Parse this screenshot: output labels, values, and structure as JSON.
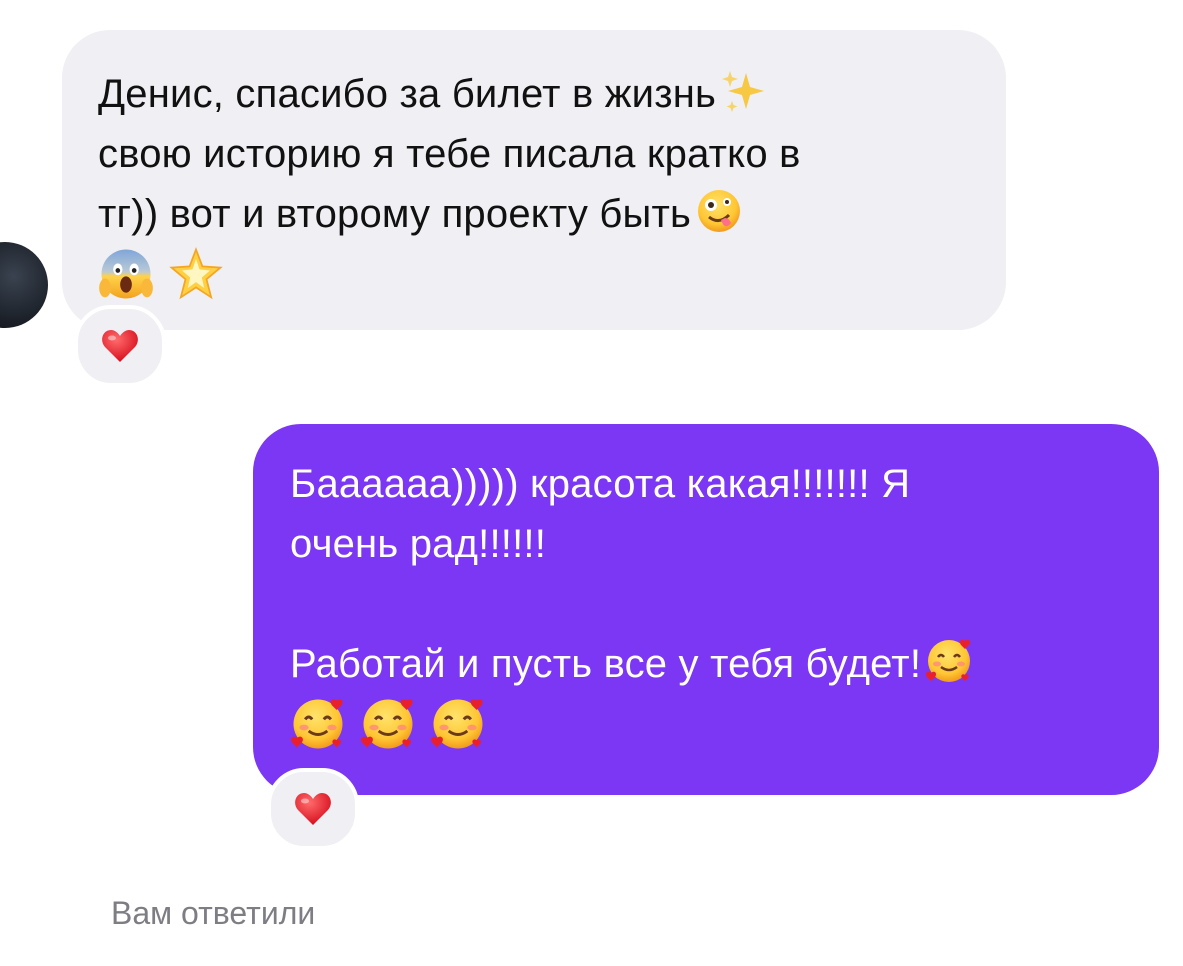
{
  "incoming": {
    "lines": [
      "Денис, спасибо за билет в жизнь",
      "свою историю я тебе писала кратко в",
      "тг)) вот и второму проекту быть"
    ],
    "line1_emoji": "sparkles-icon",
    "line3_emoji": "zany-face-icon",
    "trailing_emojis": [
      "screaming-face-icon",
      "glowing-star-icon"
    ],
    "reaction": "red-heart-icon"
  },
  "outgoing": {
    "lines": [
      "Бaaaaaa))))) красота какая!!!!!!! Я",
      "очень рад!!!!!!",
      "Работай и пусть все у тебя будет!"
    ],
    "line3_emoji": "smiling-face-with-hearts-icon",
    "trailing_emojis": [
      "smiling-face-with-hearts-icon",
      "smiling-face-with-hearts-icon",
      "smiling-face-with-hearts-icon"
    ],
    "reaction": "red-heart-icon"
  },
  "status": {
    "text": "Вам ответили"
  },
  "colors": {
    "incoming_bubble": "#efeff4",
    "outgoing_bubble": "#7b37f3",
    "reaction_heart": "#e8202e",
    "status_text": "#7d7d84"
  }
}
